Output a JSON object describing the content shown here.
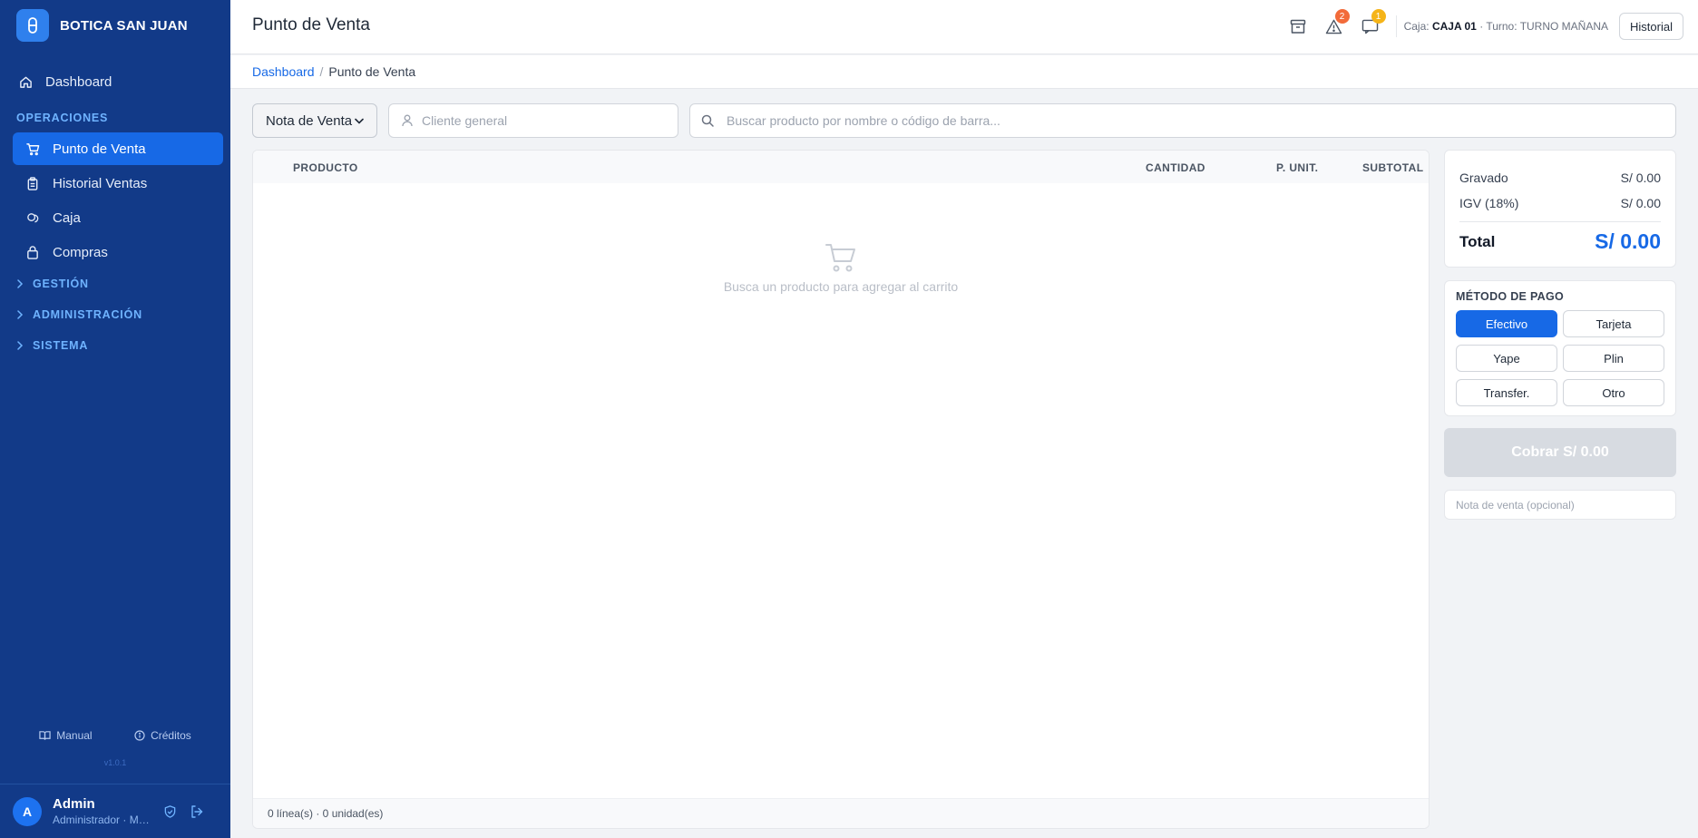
{
  "app": {
    "name": "BOTICA SAN JUAN",
    "version": "v1.0.1"
  },
  "sidebar": {
    "dashboard": "Dashboard",
    "section_label": "OPERACIONES",
    "items": [
      {
        "label": "Punto de Venta",
        "icon": "cart-icon"
      },
      {
        "label": "Historial Ventas",
        "icon": "clipboard-icon"
      },
      {
        "label": "Caja",
        "icon": "coins-icon"
      },
      {
        "label": "Compras",
        "icon": "bag-icon"
      }
    ],
    "groups": [
      "GESTIÓN",
      "ADMINISTRACIÓN",
      "SISTEMA"
    ],
    "footer_links": {
      "manual": "Manual",
      "credits": "Créditos"
    },
    "user": {
      "initial": "A",
      "name": "Admin",
      "role": "Administrador · Mi ..."
    }
  },
  "topbar": {
    "title": "Punto de Venta",
    "badges": {
      "alerts": "2",
      "messages": "1"
    },
    "caja_label": "Caja:",
    "caja_value": "CAJA 01",
    "turno_label": "· Turno:",
    "turno_value": "TURNO MAÑANA",
    "history_button": "Historial"
  },
  "breadcrumb": {
    "root": "Dashboard",
    "separator": "/",
    "current": "Punto de Venta"
  },
  "filters": {
    "document_type": "Nota de Venta",
    "client_placeholder": "Cliente general",
    "search_placeholder": "Buscar producto por nombre o código de barra..."
  },
  "cart": {
    "columns": [
      "PRODUCTO",
      "CANTIDAD",
      "P. UNIT.",
      "SUBTOTAL"
    ],
    "empty_message": "Busca un producto para agregar al carrito",
    "footer": "0 línea(s) · 0 unidad(es)"
  },
  "totals": {
    "gravado_label": "Gravado",
    "gravado_value": "S/ 0.00",
    "igv_label": "IGV (18%)",
    "igv_value": "S/ 0.00",
    "total_label": "Total",
    "total_value": "S/ 0.00"
  },
  "payment": {
    "title": "MÉTODO DE PAGO",
    "methods": [
      "Efectivo",
      "Tarjeta",
      "Yape",
      "Plin",
      "Transfer.",
      "Otro"
    ],
    "selected": "Efectivo"
  },
  "charge_button": "Cobrar S/ 0.00",
  "note_placeholder": "Nota de venta (opcional)",
  "colors": {
    "sidebar": "#123a88",
    "accent": "#1769e6",
    "badge_red": "#f26b3a",
    "badge_amber": "#f5b418"
  }
}
